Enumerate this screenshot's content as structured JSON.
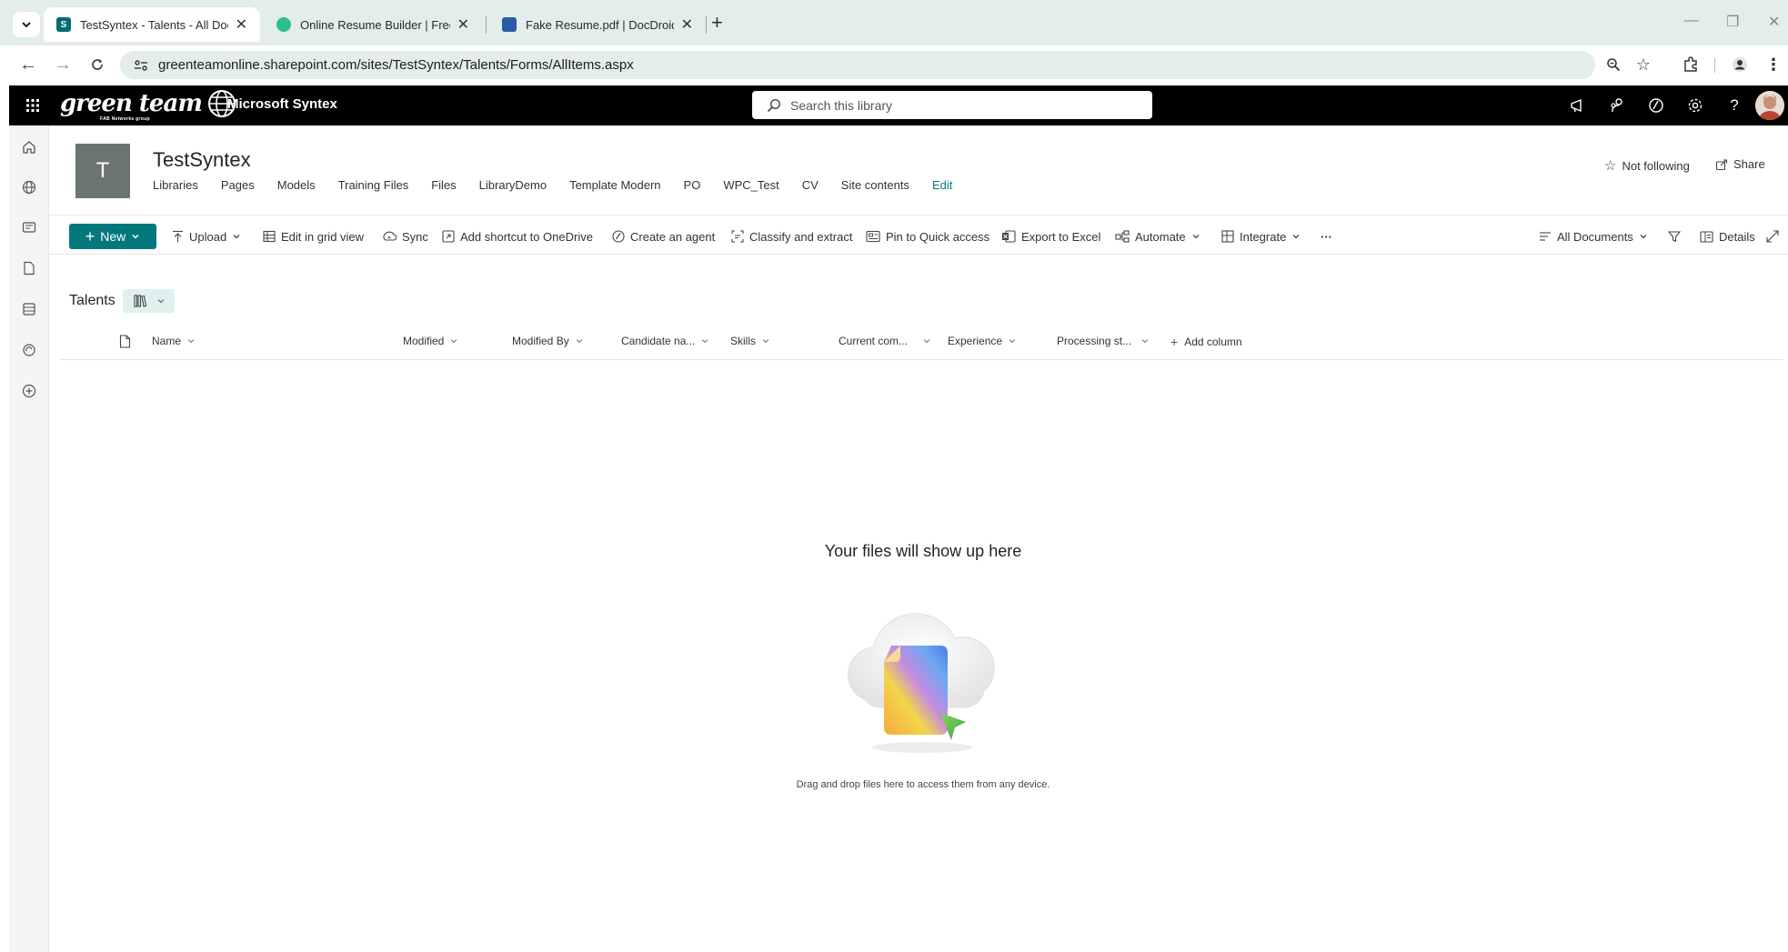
{
  "browser": {
    "tabs": [
      {
        "title": "TestSyntex - Talents - All Docum",
        "active": true,
        "favicon_color": "#036c70"
      },
      {
        "title": "Online Resume Builder | Free Re",
        "active": false,
        "favicon_color": "#2bbf8f"
      },
      {
        "title": "Fake Resume.pdf | DocDroid",
        "active": false,
        "favicon_color": "#2b5aa8"
      }
    ],
    "new_tab_label": "+",
    "url": "greenteamonline.sharepoint.com/sites/TestSyntex/Talents/Forms/AllItems.aspx"
  },
  "suite": {
    "logo_text": "green team",
    "logo_subtext": "FAB Networks group",
    "app_title": "Microsoft Syntex",
    "search_placeholder": "Search this library"
  },
  "site": {
    "logo_letter": "T",
    "title": "TestSyntex",
    "nav": [
      "Libraries",
      "Pages",
      "Models",
      "Training Files",
      "Files",
      "LibraryDemo",
      "Template Modern",
      "PO",
      "WPC_Test",
      "CV",
      "Site contents"
    ],
    "edit_label": "Edit",
    "follow_label": "Not following",
    "share_label": "Share"
  },
  "commands": {
    "new_label": "New",
    "upload": "Upload",
    "edit_grid": "Edit in grid view",
    "sync": "Sync",
    "add_shortcut": "Add shortcut to OneDrive",
    "create_agent": "Create an agent",
    "classify": "Classify and extract",
    "pin": "Pin to Quick access",
    "export": "Export to Excel",
    "automate": "Automate",
    "integrate": "Integrate",
    "more": "···",
    "view_name": "All Documents",
    "details": "Details"
  },
  "library": {
    "title": "Talents",
    "columns": [
      "Name",
      "Modified",
      "Modified By",
      "Candidate na...",
      "Skills",
      "Current com...",
      "Experience",
      "Processing st..."
    ],
    "add_column": "Add column"
  },
  "empty_state": {
    "title": "Your files will show up here",
    "subtitle": "Drag and drop files here to access them from any device."
  },
  "colors": {
    "accent": "#03787c",
    "edit_link": "#038387",
    "suite_bar": "#000000",
    "tab_strip": "#e3ede9"
  }
}
